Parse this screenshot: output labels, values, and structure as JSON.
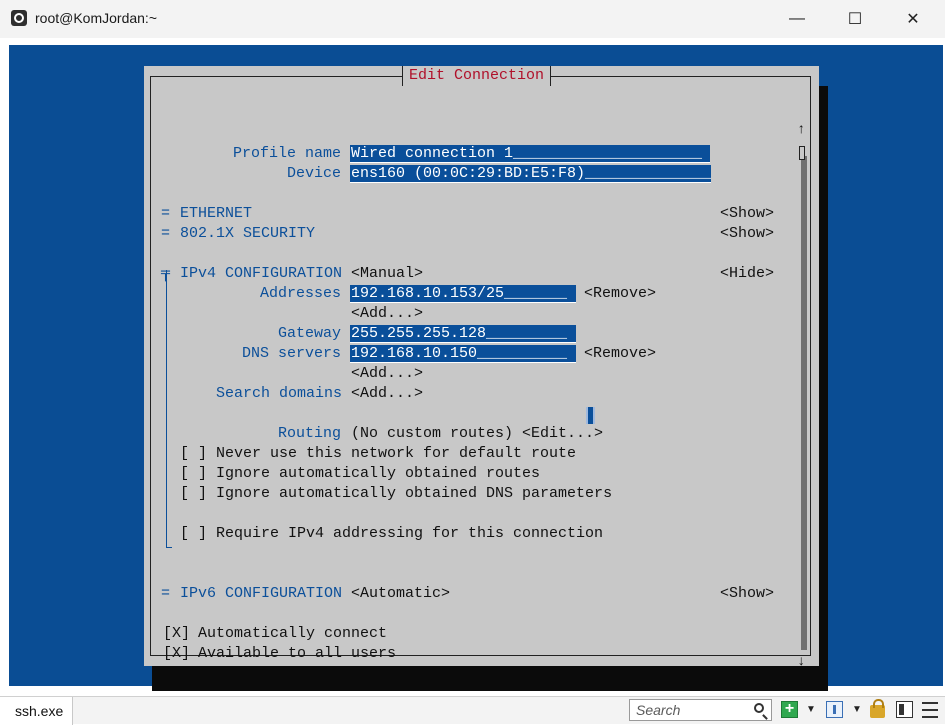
{
  "window": {
    "title": "root@KomJordan:~",
    "minimize_glyph": "—",
    "maximize_glyph": "☐",
    "close_glyph": "✕"
  },
  "dialog": {
    "title": "Edit Connection",
    "profile": {
      "label": "Profile name",
      "value": "Wired connection 1_____________________"
    },
    "device": {
      "label": "Device",
      "value": "ens160 (00:0C:29:BD:E5:F8)_______________"
    },
    "ethernet": {
      "marker": "=",
      "label": "ETHERNET",
      "action": "<Show>"
    },
    "security": {
      "marker": "=",
      "label": "802.1X SECURITY",
      "action": "<Show>"
    },
    "ipv4": {
      "marker": "╤",
      "label": "IPv4 CONFIGURATION",
      "mode": "<Manual>",
      "action": "<Hide>",
      "addresses": {
        "label": "Addresses",
        "value": "192.168.10.153/25_______",
        "remove": "<Remove>",
        "add": "<Add...>"
      },
      "gateway": {
        "label": "Gateway",
        "value": "255.255.255.128_________"
      },
      "dns": {
        "label": "DNS servers",
        "value": "192.168.10.150__________",
        "remove": "<Remove>",
        "add": "<Add...>"
      },
      "search_domains": {
        "label": "Search domains",
        "add": "<Add...>"
      },
      "routing": {
        "label": "Routing",
        "value": "(No custom routes)",
        "edit": "<Edit...>"
      },
      "checkboxes": [
        {
          "box": "[ ]",
          "label": "Never use this network for default route"
        },
        {
          "box": "[ ]",
          "label": "Ignore automatically obtained routes"
        },
        {
          "box": "[ ]",
          "label": "Ignore automatically obtained DNS parameters"
        },
        {
          "box": "[ ]",
          "label": "Require IPv4 addressing for this connection"
        }
      ]
    },
    "ipv6": {
      "marker": "=",
      "label": "IPv6 CONFIGURATION",
      "mode": "<Automatic>",
      "action": "<Show>"
    },
    "auto_connect": {
      "box": "[X]",
      "label": "Automatically connect"
    },
    "all_users": {
      "box": "[X]",
      "label": "Available to all users"
    },
    "scroll_up": "↑",
    "scroll_down": "↓"
  },
  "statusbar": {
    "tab_label": "ssh.exe",
    "search_placeholder": "Search"
  },
  "icons": {
    "app": "terminal-app-icon",
    "search": "search-icon",
    "new_console": "plus-icon",
    "view": "view-icon",
    "lock": "lock-icon",
    "layout": "layout-icon",
    "menu": "menu-icon"
  },
  "colors": {
    "terminal_blue": "#0a4d94",
    "dialog_gray": "#c8c8c8",
    "title_red": "#b0102a",
    "label_blue": "#0b4f9a",
    "field_blue": "#0a4f9a"
  }
}
